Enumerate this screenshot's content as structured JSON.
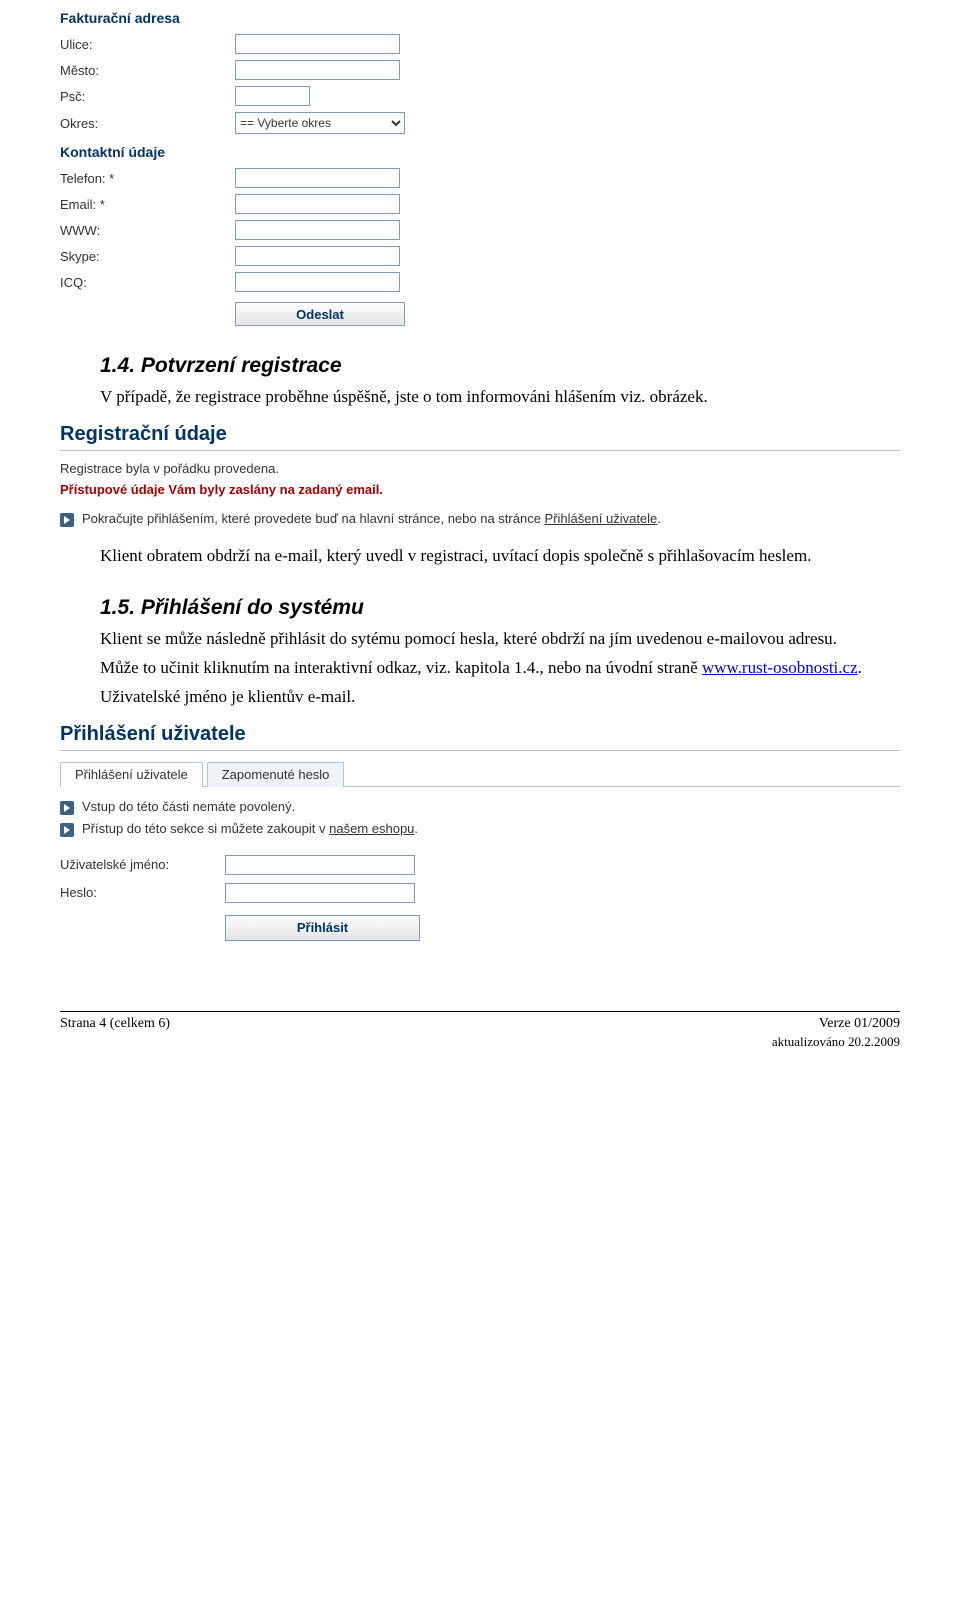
{
  "form": {
    "billing": {
      "title": "Fakturační adresa",
      "street_label": "Ulice:",
      "city_label": "Město:",
      "zip_label": "Psč:",
      "district_label": "Okres:",
      "district_placeholder": "== Vyberte okres"
    },
    "contact": {
      "title": "Kontaktní údaje",
      "phone_label": "Telefon: *",
      "email_label": "Email: *",
      "www_label": "WWW:",
      "skype_label": "Skype:",
      "icq_label": "ICQ:"
    },
    "submit_label": "Odeslat"
  },
  "section14": {
    "heading": "1.4. Potvrzení registrace",
    "para1": "V případě, že registrace proběhne úspěšně, jste o tom informováni hlášením viz. obrázek.",
    "panel_title": "Registrační údaje",
    "note1": "Registrace byla v pořádku provedena.",
    "note2": "Přístupové údaje Vám byly zaslány na zadaný email.",
    "bullet_pre": "Pokračujte přihlášením, které provedete buď na hlavní stránce, nebo na stránce ",
    "bullet_link": "Přihlášení uživatele",
    "bullet_post": ".",
    "para2": "Klient obratem obdrží na e-mail, který uvedl v registraci, uvítací dopis společně s přihlašovacím heslem."
  },
  "section15": {
    "heading": "1.5. Přihlášení do systému",
    "para1": "Klient se může následně přihlásit do sytému pomocí hesla, které obdrží na jím uvedenou e-mailovou adresu.",
    "para2_pre": "Může to učinit kliknutím na interaktivní odkaz, viz. kapitola 1.4., nebo na úvodní straně ",
    "para2_link": "www.rust-osobnosti.cz",
    "para2_post": ".",
    "para3": "Uživatelské jméno je klientův e-mail.",
    "panel_title": "Přihlášení uživatele",
    "tab1": "Přihlášení uživatele",
    "tab2": "Zapomenuté heslo",
    "bullet1": "Vstup do této části nemáte povolený.",
    "bullet2_pre": "Přístup do této sekce si můžete zakoupit v ",
    "bullet2_link": "našem eshopu",
    "bullet2_post": ".",
    "username_label": "Uživatelské jméno:",
    "password_label": "Heslo:",
    "login_button": "Přihlásit"
  },
  "footer": {
    "page": "Strana 4 (celkem 6)",
    "version": "Verze 01/2009",
    "updated": "aktualizováno 20.2.2009"
  }
}
